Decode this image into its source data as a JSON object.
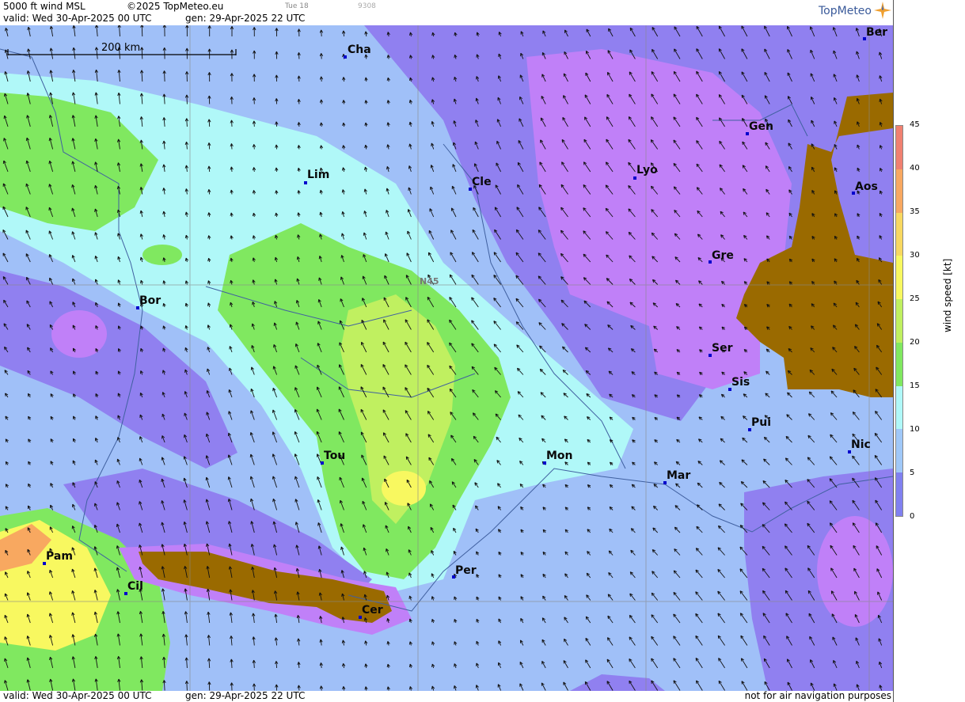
{
  "header": {
    "product": "5000 ft wind MSL",
    "copyright": "©2025 TopMeteo.eu",
    "run_day": "Tue 18",
    "code": "9308",
    "valid": "valid:  Wed  30-Apr-2025  00 UTC",
    "generated": "gen:  29-Apr-2025 22 UTC"
  },
  "footer": {
    "valid": "valid:  Wed  30-Apr-2025  00 UTC",
    "generated": "gen: 29-Apr-2025 22 UTC",
    "disclaimer": "not for air navigation purposes"
  },
  "logo": "TopMeteo",
  "scale_bar": "200 km",
  "grid_label": "N45",
  "legend": {
    "title": "wind  speed  [kt]",
    "ticks": [
      "45",
      "40",
      "35",
      "30",
      "25",
      "20",
      "15",
      "10",
      "5",
      "0"
    ],
    "colors": [
      "#f08070",
      "#f8a860",
      "#f8d860",
      "#f8f860",
      "#c0f060",
      "#80e860",
      "#b0f8f8",
      "#a0c8f8",
      "#8080f0",
      "#c080f8"
    ]
  },
  "cities": [
    {
      "label": "Cha"
    },
    {
      "label": "Ber"
    },
    {
      "label": "Gen"
    },
    {
      "label": "Lim"
    },
    {
      "label": "Cle"
    },
    {
      "label": "Lyo"
    },
    {
      "label": "Aos"
    },
    {
      "label": "Gre"
    },
    {
      "label": "Bor"
    },
    {
      "label": "Ser"
    },
    {
      "label": "Sis"
    },
    {
      "label": "Pui"
    },
    {
      "label": "Tou"
    },
    {
      "label": "Mon"
    },
    {
      "label": "Nic"
    },
    {
      "label": "Mar"
    },
    {
      "label": "Pam"
    },
    {
      "label": "Cil"
    },
    {
      "label": "Per"
    },
    {
      "label": "Cer"
    }
  ],
  "colors": {
    "calm": "#c080f8",
    "light": "#9080f0",
    "moderate": "#a0c0f8",
    "fresh": "#b0f8f8",
    "strong": "#80e860",
    "stronger": "#c0f060",
    "max": "#f8f860",
    "terrain": "#9a6a00"
  }
}
